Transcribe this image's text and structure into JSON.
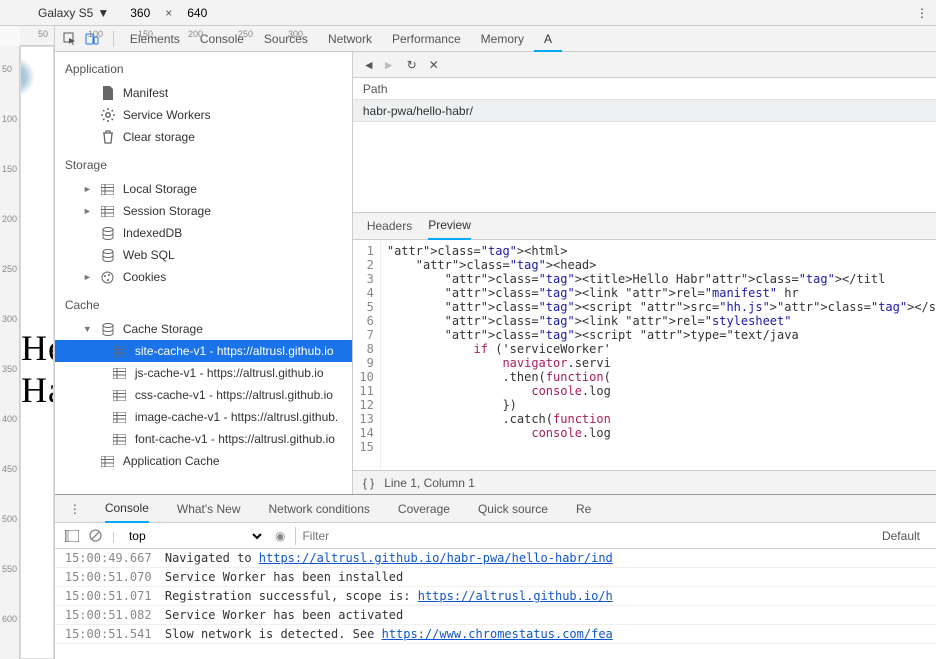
{
  "device": {
    "name": "Galaxy S5",
    "width": "360",
    "height": "640"
  },
  "ruler_h": [
    "50",
    "100",
    "150",
    "200",
    "250",
    "300"
  ],
  "ruler_v": [
    "50",
    "100",
    "150",
    "200",
    "250",
    "300",
    "350",
    "400",
    "450",
    "500",
    "550",
    "600"
  ],
  "page": {
    "hello": "Hello Habr"
  },
  "tabs": [
    "Elements",
    "Console",
    "Sources",
    "Network",
    "Performance",
    "Memory",
    "A"
  ],
  "app_sidebar": {
    "sections": {
      "application": {
        "title": "Application",
        "items": [
          {
            "icon": "manifest",
            "label": "Manifest"
          },
          {
            "icon": "gear",
            "label": "Service Workers"
          },
          {
            "icon": "trash",
            "label": "Clear storage"
          }
        ]
      },
      "storage": {
        "title": "Storage",
        "items": [
          {
            "tri": "►",
            "icon": "grid",
            "label": "Local Storage"
          },
          {
            "tri": "►",
            "icon": "grid",
            "label": "Session Storage"
          },
          {
            "icon": "db",
            "label": "IndexedDB"
          },
          {
            "icon": "db",
            "label": "Web SQL"
          },
          {
            "tri": "►",
            "icon": "cookie",
            "label": "Cookies"
          }
        ]
      },
      "cache": {
        "title": "Cache",
        "header": {
          "tri": "▼",
          "icon": "db",
          "label": "Cache Storage"
        },
        "items": [
          {
            "label": "site-cache-v1 - https://altrusl.github.io",
            "selected": true
          },
          {
            "label": "js-cache-v1 - https://altrusl.github.io"
          },
          {
            "label": "css-cache-v1 - https://altrusl.github.io"
          },
          {
            "label": "image-cache-v1 - https://altrusl.github."
          },
          {
            "label": "font-cache-v1 - https://altrusl.github.io"
          }
        ],
        "footer": {
          "icon": "grid",
          "label": "Application Cache"
        }
      }
    }
  },
  "detail": {
    "path_header": "Path",
    "path_value": "habr-pwa/hello-habr/",
    "sub_tabs": [
      "Headers",
      "Preview"
    ],
    "status": "Line 1, Column 1"
  },
  "code_lines": [
    "<html>",
    "    <head>",
    "        <title>Hello Habr</titl",
    "        <link rel=\"manifest\" hr",
    "        <script src=\"hh.js\"></s",
    "        <link rel=\"stylesheet\" ",
    "        <script type=\"text/java",
    "            if ('serviceWorker'",
    "                navigator.servi",
    "                .then(function(",
    "                    console.log",
    "                })",
    "                .catch(function",
    "                    console.log",
    ""
  ],
  "drawer": {
    "tabs": [
      "Console",
      "What's New",
      "Network conditions",
      "Coverage",
      "Quick source",
      "Re"
    ],
    "filter": {
      "context": "top",
      "placeholder": "Filter",
      "level": "Default"
    },
    "logs": [
      {
        "ts": "15:00:49.667",
        "html": "Navigated to <a>https://altrusl.github.io/habr-pwa/hello-habr/ind</a>"
      },
      {
        "ts": "15:00:51.070",
        "html": "Service Worker has been installed"
      },
      {
        "ts": "15:00:51.071",
        "html": "Registration successful, scope is: <a>https://altrusl.github.io/h</a>"
      },
      {
        "ts": "15:00:51.082",
        "html": "Service Worker has been activated"
      },
      {
        "ts": "15:00:51.541",
        "html": "Slow network is detected. See <a>https://www.chromestatus.com/fea</a>"
      }
    ]
  }
}
